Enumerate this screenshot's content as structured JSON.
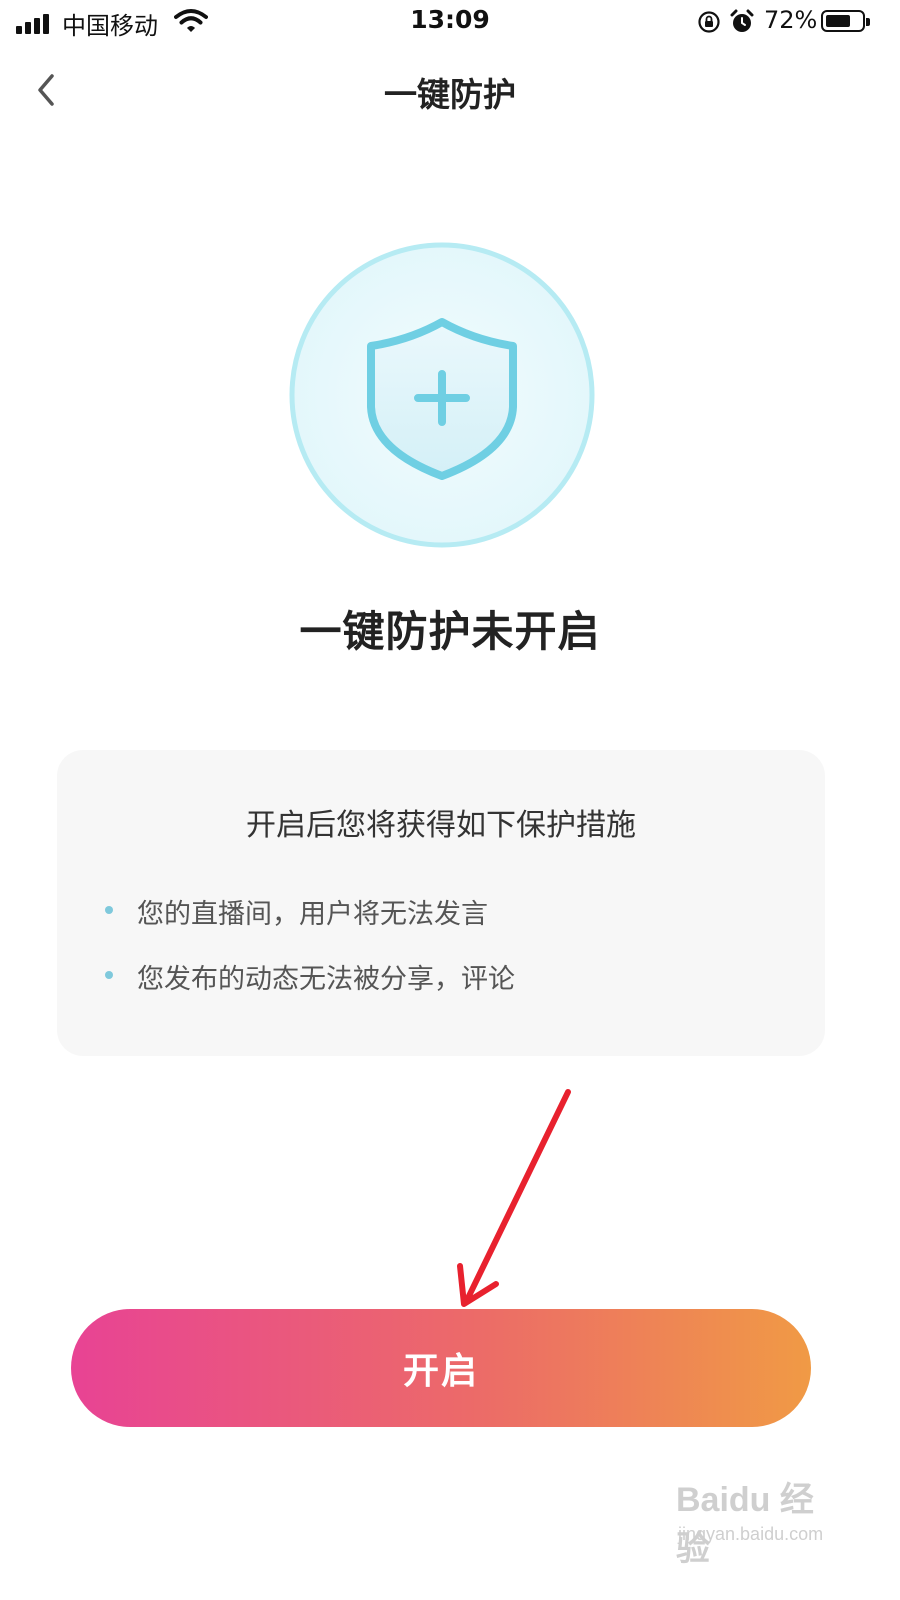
{
  "status_bar": {
    "carrier": "中国移动",
    "time": "13:09",
    "battery_percent": "72%",
    "battery_level": 0.72,
    "icons": [
      "signal-icon",
      "wifi-icon",
      "orientation-lock-icon",
      "alarm-icon",
      "battery-icon"
    ]
  },
  "nav": {
    "back_icon": "chevron-left-icon",
    "title": "一键防护"
  },
  "hero": {
    "icon": "shield-plus-icon",
    "status_text": "一键防护未开启"
  },
  "card": {
    "title": "开启后您将获得如下保护措施",
    "items": [
      "您的直播间，用户将无法发言",
      "您发布的动态无法被分享，评论"
    ]
  },
  "action": {
    "enable_label": "开启"
  },
  "annotation": {
    "arrow_icon": "red-arrow-annotation"
  },
  "watermark": {
    "logo": "Baidu 经验",
    "url": "jingyan.baidu.com"
  },
  "colors": {
    "button_gradient_start": "#e84394",
    "button_gradient_end": "#f09a45",
    "shield_stroke": "#6fcfe3",
    "circle_fill": "#e8f9fc",
    "arrow": "#e8212e"
  }
}
